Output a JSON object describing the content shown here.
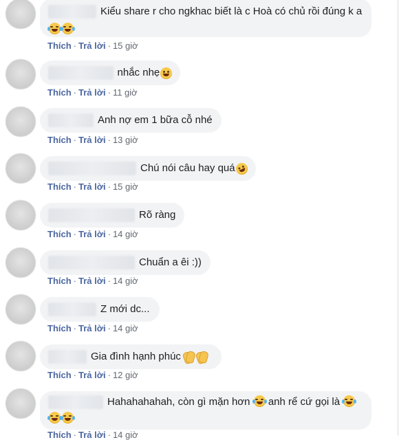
{
  "comments": [
    {
      "id": "c1",
      "name_hidden": true,
      "text": "Kiểu share r cho ngkhac biết là c Hoà có chủ rồi đúng k a",
      "emoji_after": [],
      "line2_emoji": [
        "tears-of-joy",
        "tears-of-joy"
      ],
      "like": "Thích",
      "reply": "Trả lời",
      "time": "15 giờ"
    },
    {
      "id": "c2",
      "name_hidden": true,
      "text": "nhắc nhẹ",
      "emoji_after": [
        "grinning"
      ],
      "like": "Thích",
      "reply": "Trả lời",
      "time": "11 giờ"
    },
    {
      "id": "c3",
      "name_hidden": true,
      "text": "Anh nợ em 1 bữa cỗ nhé",
      "emoji_after": [],
      "like": "Thích",
      "reply": "Trả lời",
      "time": "13 giờ"
    },
    {
      "id": "c4",
      "name_hidden": true,
      "text": "Chú nói câu hay quá",
      "emoji_after": [
        "rofl"
      ],
      "like": "Thích",
      "reply": "Trả lời",
      "time": "15 giờ"
    },
    {
      "id": "c5",
      "name_hidden": true,
      "text": "Rõ ràng",
      "emoji_after": [],
      "like": "Thích",
      "reply": "Trả lời",
      "time": "14 giờ"
    },
    {
      "id": "c6",
      "name_hidden": true,
      "text": "Chuẩn a êi :))",
      "emoji_after": [],
      "like": "Thích",
      "reply": "Trả lời",
      "time": "14 giờ"
    },
    {
      "id": "c7",
      "name_hidden": true,
      "text": "Z mới dc...",
      "emoji_after": [],
      "like": "Thích",
      "reply": "Trả lời",
      "time": "14 giờ"
    },
    {
      "id": "c8",
      "name_hidden": true,
      "text": "Gia đình hạnh phúc",
      "emoji_after": [
        "clap",
        "clap"
      ],
      "like": "Thích",
      "reply": "Trả lời",
      "time": "12 giờ"
    },
    {
      "id": "c9",
      "name_hidden": true,
      "text": "Hahahahahah, còn gì mặn hơn",
      "text2": "anh rể cứ gọi là",
      "emoji_after": [],
      "line2_emoji": [
        "tears-of-joy",
        "tears-of-joy"
      ],
      "like": "Thích",
      "reply": "Trả lời",
      "time": "14 giờ"
    }
  ],
  "colors": {
    "link": "#4b67a1",
    "bubble": "#f2f3f5",
    "text": "#1c1e21",
    "meta": "#616770"
  }
}
